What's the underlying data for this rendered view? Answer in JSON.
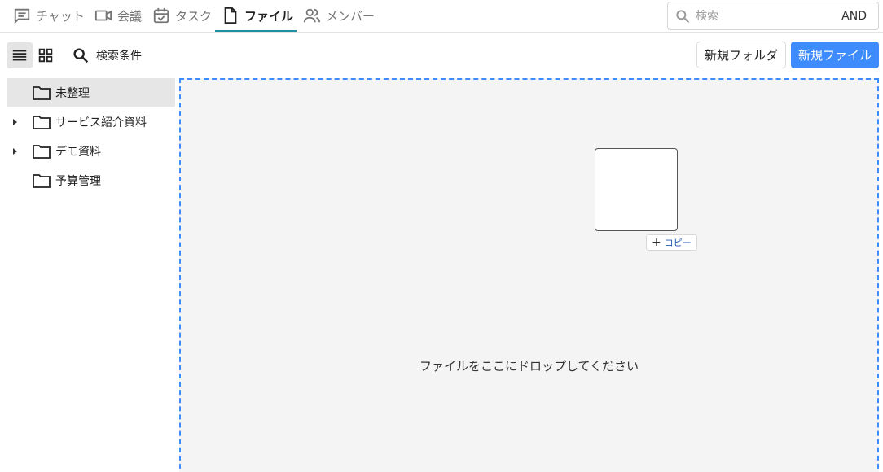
{
  "tabs": [
    {
      "label": "チャット",
      "icon": "chat-icon"
    },
    {
      "label": "会議",
      "icon": "video-icon"
    },
    {
      "label": "タスク",
      "icon": "task-icon"
    },
    {
      "label": "ファイル",
      "icon": "file-icon",
      "active": true
    },
    {
      "label": "メンバー",
      "icon": "members-icon"
    }
  ],
  "search": {
    "placeholder": "検索",
    "mode": "AND"
  },
  "toolbar": {
    "filter_label": "検索条件",
    "new_folder_label": "新規フォルダ",
    "new_file_label": "新規ファイル"
  },
  "sidebar": {
    "items": [
      {
        "label": "未整理",
        "expandable": false,
        "selected": true
      },
      {
        "label": "サービス紹介資料",
        "expandable": true
      },
      {
        "label": "デモ資料",
        "expandable": true
      },
      {
        "label": "予算管理",
        "expandable": false
      }
    ]
  },
  "dropzone": {
    "message": "ファイルをここにドロップしてください",
    "copy_label": "コピー"
  },
  "colors": {
    "accent": "#3d8bfd",
    "tab_underline": "#1f8fa3",
    "dropzone_bg": "#f4f4f4"
  }
}
